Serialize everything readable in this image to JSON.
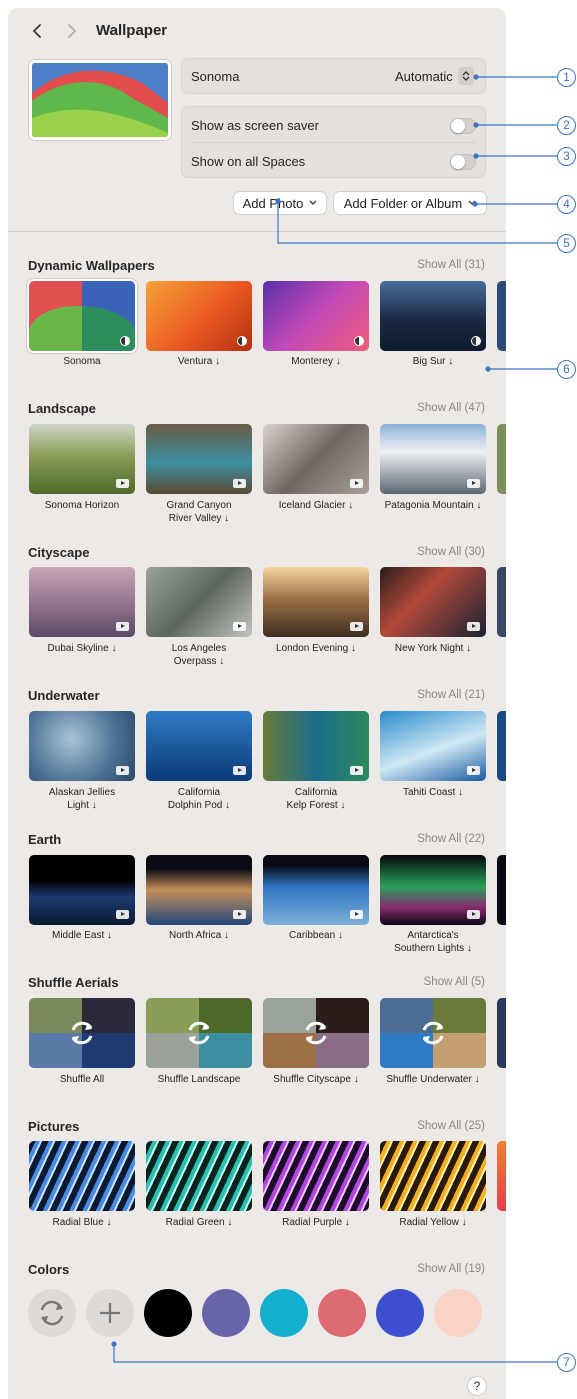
{
  "window": {
    "title": "Wallpaper"
  },
  "current": {
    "name": "Sonoma",
    "mode": "Automatic",
    "screen_saver_label": "Show as screen saver",
    "screen_saver_on": false,
    "all_spaces_label": "Show on all Spaces",
    "all_spaces_on": false
  },
  "actions": {
    "add_photo": "Add Photo",
    "add_folder": "Add Folder or Album"
  },
  "sections": {
    "dynamic": {
      "title": "Dynamic Wallpapers",
      "show_all": "Show All (31)",
      "items": [
        "Sonoma",
        "Ventura ↓",
        "Monterey ↓",
        "Big Sur ↓"
      ]
    },
    "landscape": {
      "title": "Landscape",
      "show_all": "Show All (47)",
      "items": [
        "Sonoma Horizon",
        "Grand Canyon\nRiver Valley ↓",
        "Iceland Glacier ↓",
        "Patagonia Mountain ↓"
      ]
    },
    "cityscape": {
      "title": "Cityscape",
      "show_all": "Show All (30)",
      "items": [
        "Dubai Skyline ↓",
        "Los Angeles\nOverpass ↓",
        "London Evening ↓",
        "New York Night ↓"
      ]
    },
    "underwater": {
      "title": "Underwater",
      "show_all": "Show All (21)",
      "items": [
        "Alaskan Jellies\nLight ↓",
        "California\nDolphin Pod ↓",
        "California\nKelp Forest ↓",
        "Tahiti Coast ↓"
      ]
    },
    "earth": {
      "title": "Earth",
      "show_all": "Show All (22)",
      "items": [
        "Middle East ↓",
        "North Africa ↓",
        "Caribbean ↓",
        "Antarctica's\nSouthern Lights ↓"
      ]
    },
    "shuffle": {
      "title": "Shuffle Aerials",
      "show_all": "Show All (5)",
      "items": [
        "Shuffle All",
        "Shuffle Landscape",
        "Shuffle Cityscape ↓",
        "Shuffle Underwater ↓"
      ]
    },
    "pictures": {
      "title": "Pictures",
      "show_all": "Show All (25)",
      "items": [
        "Radial Blue ↓",
        "Radial Green ↓",
        "Radial Purple ↓",
        "Radial Yellow ↓"
      ]
    },
    "colors": {
      "title": "Colors",
      "show_all": "Show All (19)"
    }
  },
  "colors": [
    "#000000",
    "#6864a8",
    "#12b0cc",
    "#de6b71",
    "#3d4fce",
    "#f8d3c6"
  ],
  "help": "?",
  "callouts": [
    "1",
    "2",
    "3",
    "4",
    "5",
    "6",
    "7"
  ],
  "icons": [
    "chevron-left-icon",
    "chevron-right-icon",
    "stepper-icon",
    "chevron-down-icon",
    "play-icon",
    "dynamic-icon",
    "shuffle-icon",
    "refresh-icon",
    "plus-icon",
    "help-icon"
  ],
  "accent": "#3b74c4"
}
